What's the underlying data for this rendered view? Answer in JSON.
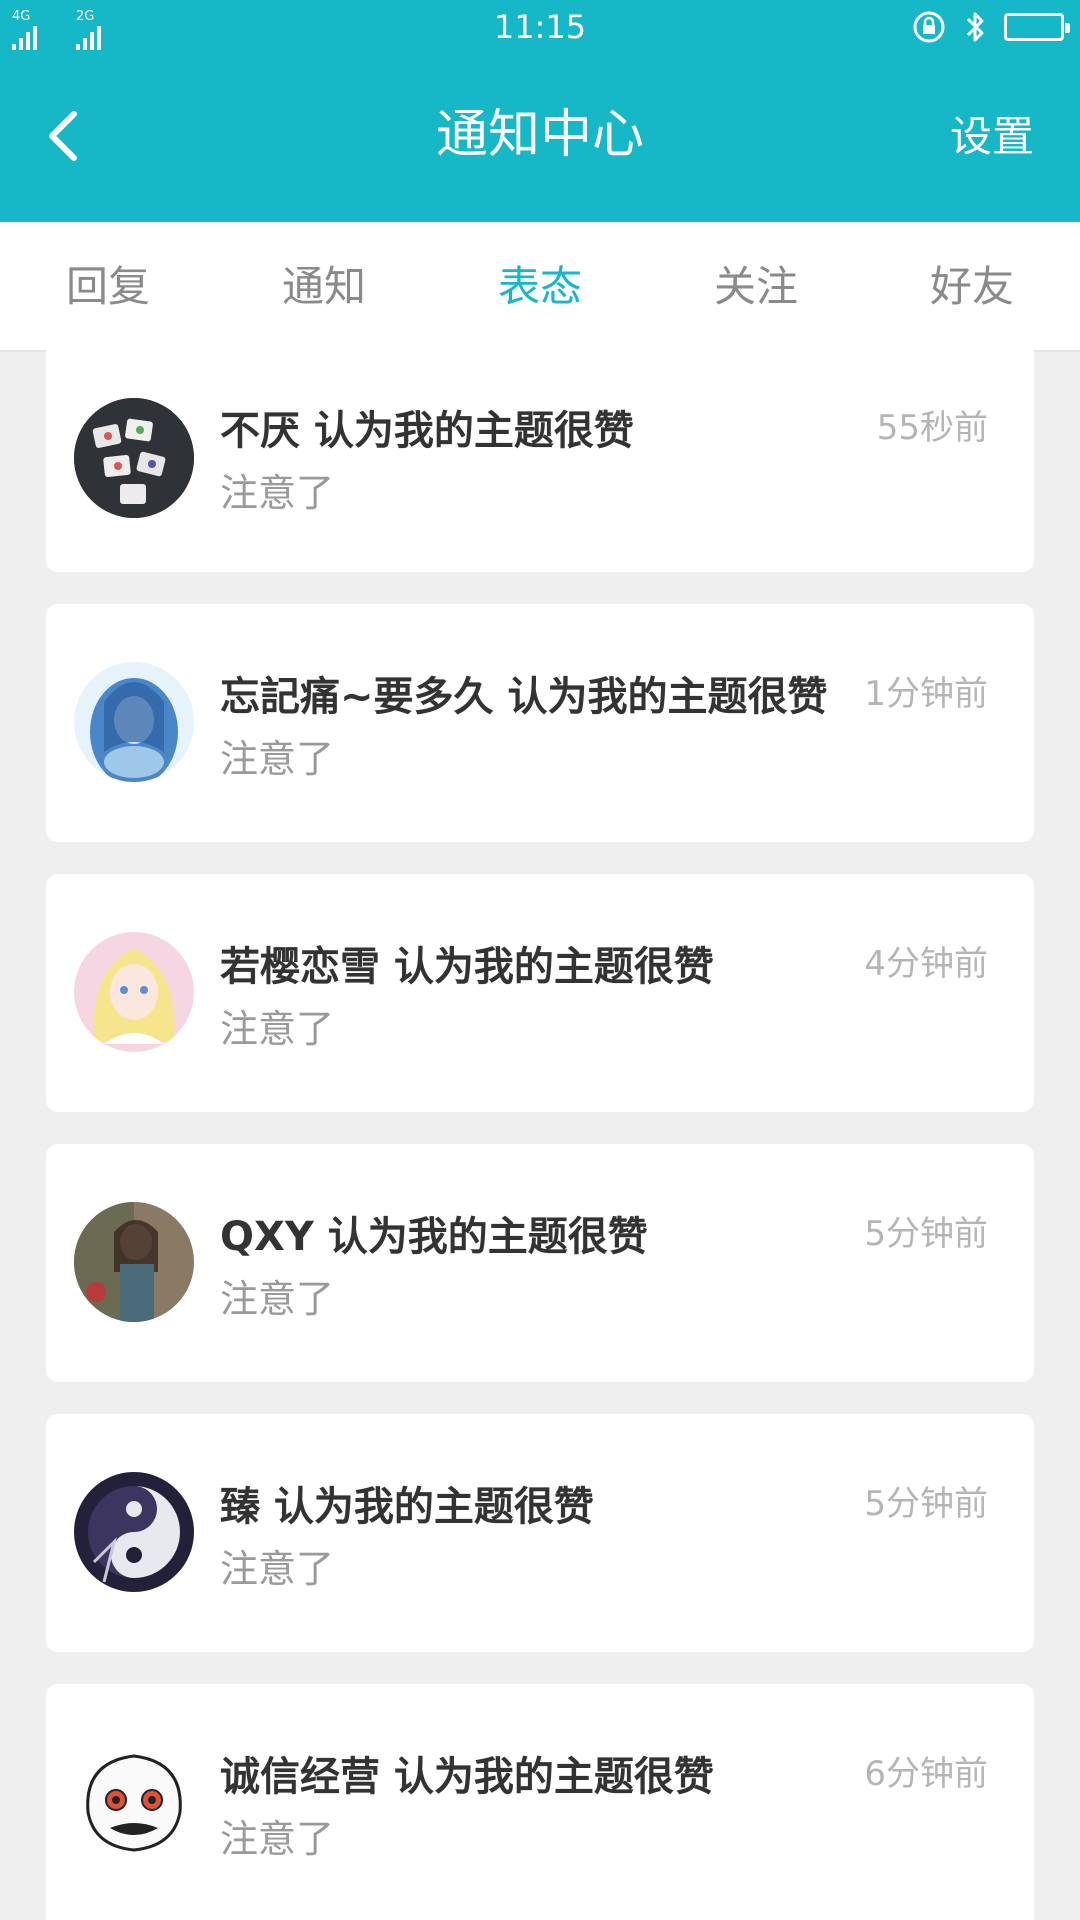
{
  "status_bar": {
    "time": "11:15",
    "sim1_label": "4G",
    "sim2_label": "2G"
  },
  "header": {
    "title": "通知中心",
    "settings_label": "设置"
  },
  "tabs": [
    {
      "label": "回复",
      "active": false
    },
    {
      "label": "通知",
      "active": false
    },
    {
      "label": "表态",
      "active": true
    },
    {
      "label": "关注",
      "active": false
    },
    {
      "label": "好友",
      "active": false
    }
  ],
  "notifications": [
    {
      "user": "不厌",
      "action": "认为我的主题很赞",
      "snippet": "注意了",
      "time": "55秒前",
      "avatar": "mahjong-photo"
    },
    {
      "user": "忘記痛~要多久",
      "action": "认为我的主题很赞",
      "snippet": "注意了",
      "time": "1分钟前",
      "avatar": "anime-blue-girl"
    },
    {
      "user": "若樱恋雪",
      "action": "认为我的主题很赞",
      "snippet": "注意了",
      "time": "4分钟前",
      "avatar": "anime-blonde-girl"
    },
    {
      "user": "QXY",
      "action": "认为我的主题很赞",
      "snippet": "注意了",
      "time": "5分钟前",
      "avatar": "painting-girl"
    },
    {
      "user": "臻",
      "action": "认为我的主题很赞",
      "snippet": "注意了",
      "time": "5分钟前",
      "avatar": "dark-circle-art"
    },
    {
      "user": "诚信经营",
      "action": "认为我的主题很赞",
      "snippet": "注意了",
      "time": "6分钟前",
      "avatar": "white-sketch-character"
    }
  ],
  "colors": {
    "accent": "#16b7c6",
    "background": "#efefef"
  }
}
